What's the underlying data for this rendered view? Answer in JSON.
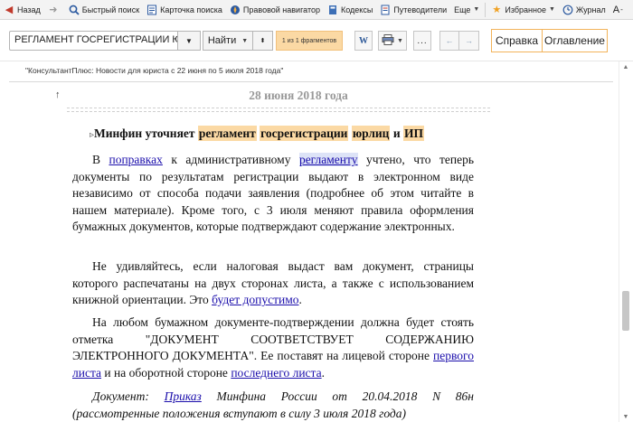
{
  "toolbar": {
    "items": [
      {
        "label": "Назад",
        "icon": "back-arrow-icon"
      },
      {
        "label": "",
        "icon": "forward-arrow-icon"
      },
      {
        "label": "Быстрый поиск",
        "icon": "search-icon"
      },
      {
        "label": "Карточка поиска",
        "icon": "search-card-icon"
      },
      {
        "label": "Правовой навигатор",
        "icon": "legal-navigator-icon"
      },
      {
        "label": "Кодексы",
        "icon": "codes-icon"
      },
      {
        "label": "Путеводители",
        "icon": "guides-icon"
      },
      {
        "label": "Еще",
        "icon": ""
      },
      {
        "label": "Избранное",
        "icon": "favorites-icon"
      },
      {
        "label": "Журнал",
        "icon": "journal-icon"
      }
    ],
    "font_size_label": "A",
    "font_size_sign": "-"
  },
  "search": {
    "value": "РЕГЛАМЕНТ ГОСРЕГИСТРАЦИИ ЮРЛИЦ",
    "find_label": "Найти",
    "match_text": "1 из 1 фрагментов"
  },
  "buttons": {
    "word_label": "W",
    "more_label": "..."
  },
  "tabs": {
    "help": "Справка",
    "toc": "Оглавление"
  },
  "document": {
    "header": "\"КонсультантПлюс: Новости для юриста с 22 июня по 5 июля 2018 года\"",
    "date_heading": "28 июня 2018 года",
    "title": {
      "t1": "Минфин уточняет ",
      "h1": "регламент",
      "h2": "госрегистрации",
      "h3": "юрлиц",
      "t2": " и ",
      "h4": "ИП"
    },
    "p1": {
      "t1": "В ",
      "l1": "поправках",
      "t2": " к административному ",
      "l2": "регламенту",
      "t3": " учтено, что теперь документы по результатам регистрации выдают в электронном виде независимо от способа подачи заявления (подробнее об этом читайте в нашем материале). Кроме того, с 3 июля меняют правила оформления бумажных документов, которые подтверждают содержание электронных."
    },
    "p2": {
      "t1": "Не удивляйтесь, если налоговая выдаст вам документ, страницы которого распечатаны на двух сторонах листа, а также с использованием книжной ориентации. Это ",
      "l1": "будет допустимо",
      "t2": "."
    },
    "p3": {
      "t1": "На любом бумажном документе-подтверждении должна будет стоять отметка \"ДОКУМЕНТ СООТВЕТСТВУЕТ СОДЕРЖАНИЮ ЭЛЕКТРОННОГО ДОКУМЕНТА\". Ее поставят на лицевой стороне ",
      "l1": "первого листа",
      "t2": " и на оборотной стороне ",
      "l2": "последнего листа",
      "t3": "."
    },
    "p4": {
      "t1": "Документ: ",
      "l1": "Приказ",
      "t2": " Минфина России от 20.04.2018 N 86н (рассмотренные положения вступают в силу 3 июля 2018 года)"
    }
  },
  "colors": {
    "highlight": "#fbd9a4",
    "tab_border": "#f2b35a",
    "link": "#1a0dab",
    "date_heading": "#999999"
  }
}
